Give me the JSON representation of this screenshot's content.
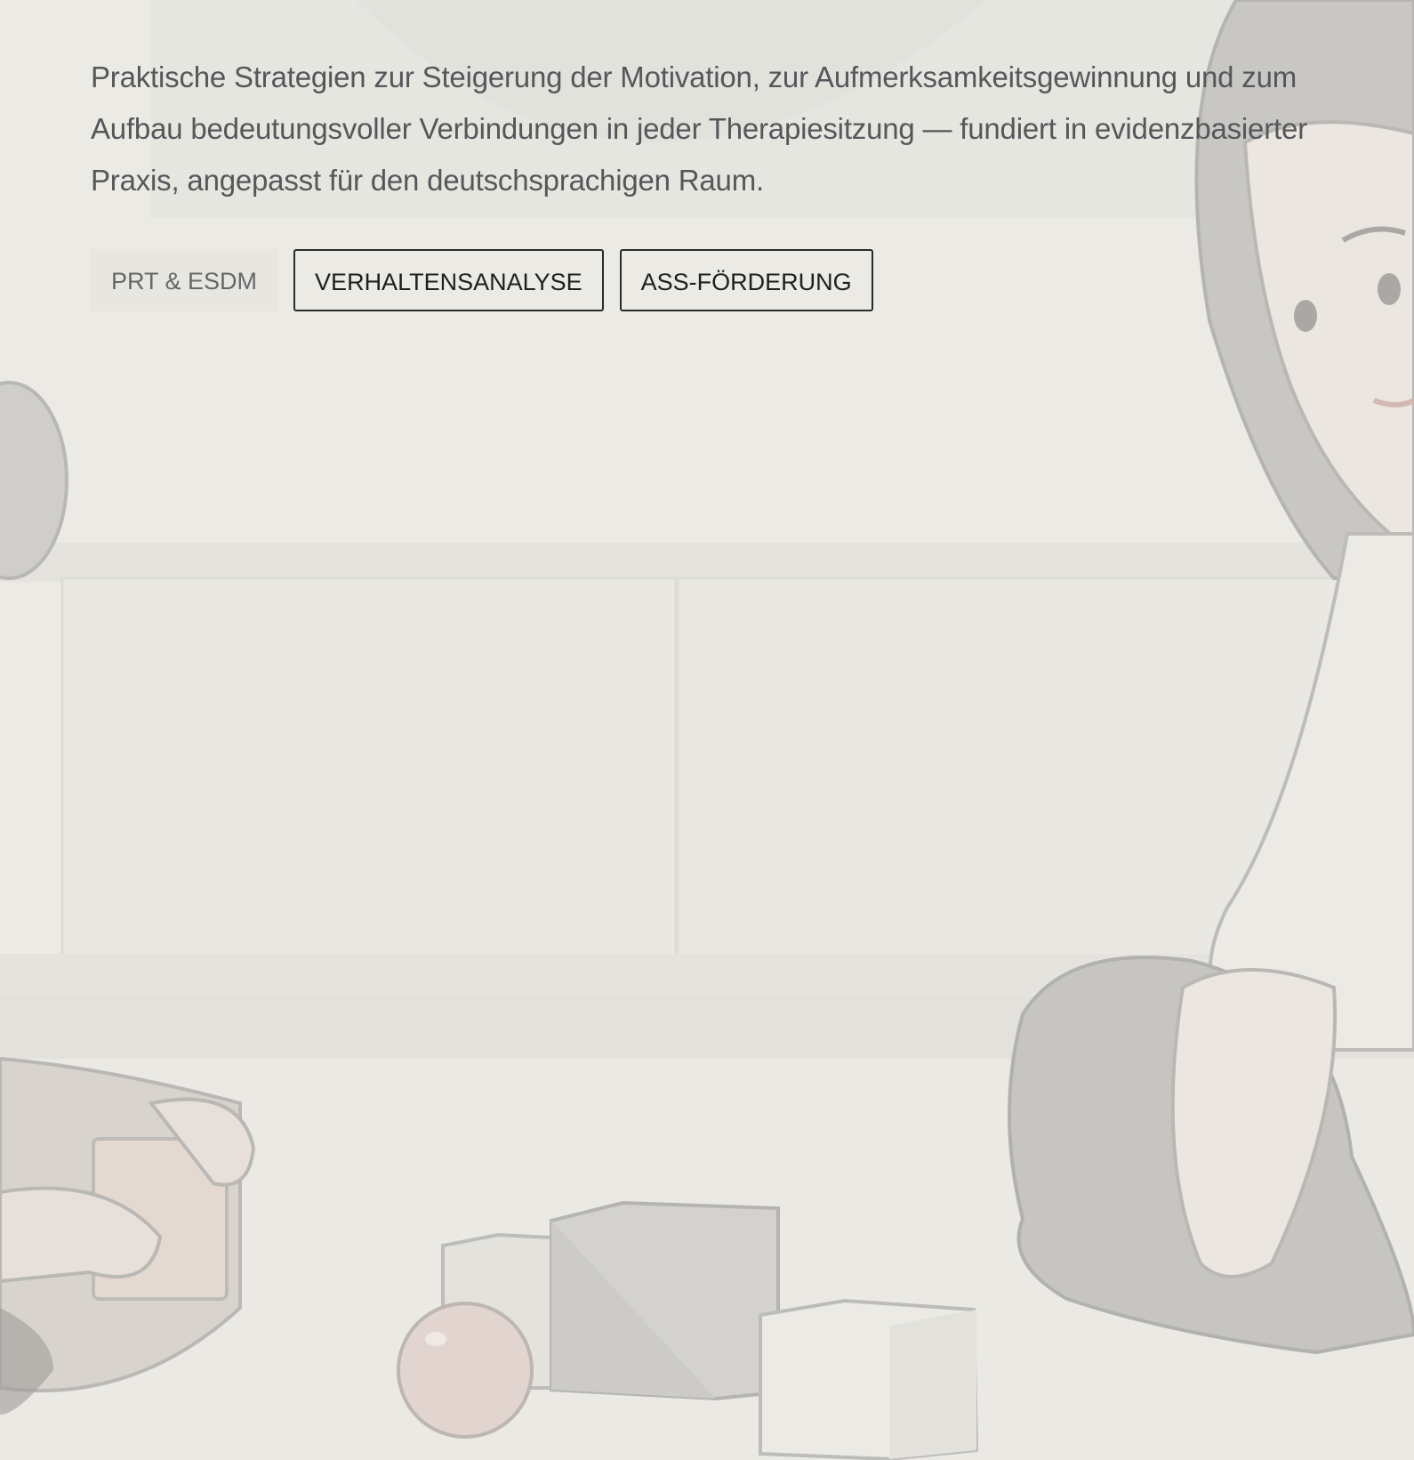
{
  "hero": {
    "description": "Praktische Strategien zur Steigerung der Motivation, zur Aufmerksamkeitsgewinnung und zum Aufbau bedeutungsvoller Verbindungen in jeder Therapiesitzung — fundiert in evidenzbasierter Praxis, angepasst für den deutschsprachigen Raum."
  },
  "tags": [
    {
      "label": "PRT & ESDM"
    },
    {
      "label": "VERHALTENSANALYSE"
    },
    {
      "label": "ASS-FÖRDERUNG"
    }
  ],
  "colors": {
    "background": "#ebeae5",
    "text": "#55575a",
    "outline": "#2b2b2b"
  }
}
